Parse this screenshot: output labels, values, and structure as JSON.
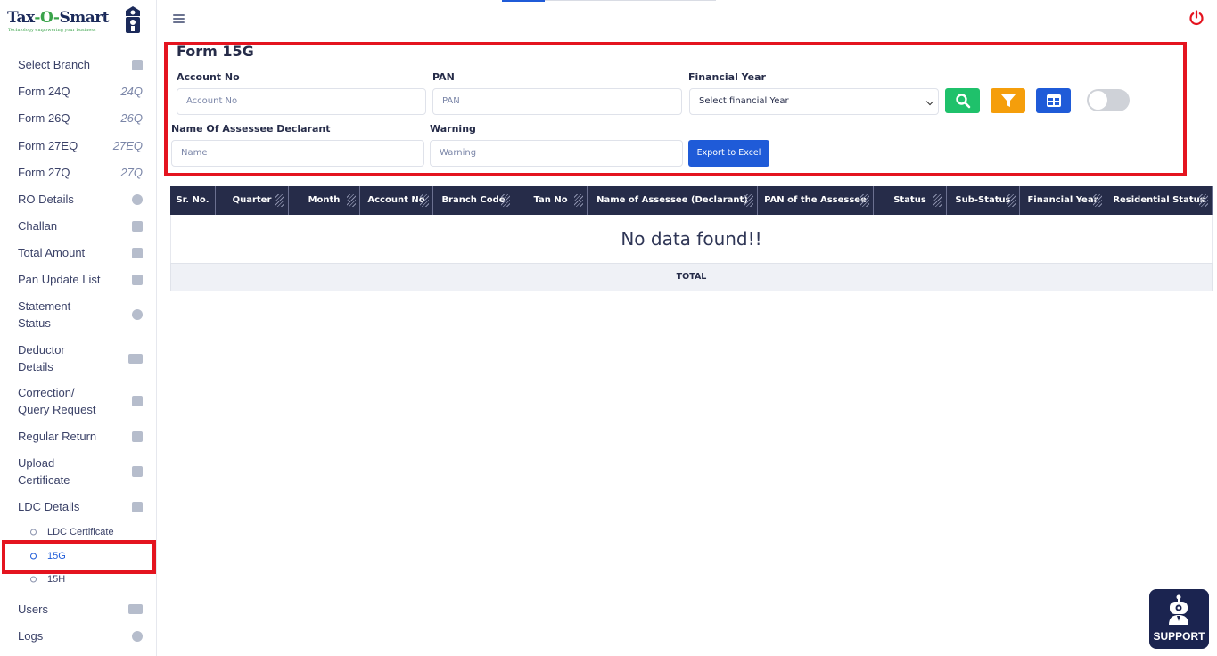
{
  "brand": {
    "name_left": "Tax",
    "name_dash1": "-",
    "name_o": "O",
    "name_dash2": "-",
    "name_right": "Smart",
    "tagline": "Technology empowering your business"
  },
  "sidebar": {
    "items": [
      {
        "label": "Select Branch",
        "icon": "id-card-icon"
      },
      {
        "label": "Form 24Q",
        "abbr": "24Q"
      },
      {
        "label": "Form 26Q",
        "abbr": "26Q"
      },
      {
        "label": "Form 27EQ",
        "abbr": "27EQ"
      },
      {
        "label": "Form 27Q",
        "abbr": "27Q"
      },
      {
        "label": "RO Details",
        "icon": "info-icon"
      },
      {
        "label": "Challan",
        "icon": "receipt-icon"
      },
      {
        "label": "Total Amount",
        "icon": "wallet-icon"
      },
      {
        "label": "Pan Update List",
        "icon": "clipboard-icon"
      },
      {
        "label": "Statement Status",
        "line1": "Statement",
        "line2": "Status",
        "icon": "clock-icon"
      },
      {
        "label": "Deductor Details",
        "line1": "Deductor",
        "line2": "Details",
        "icon": "credit-card-icon"
      },
      {
        "label": "Correction/ Query Request",
        "line1": "Correction/",
        "line2": "Query Request",
        "icon": "calendar-icon"
      },
      {
        "label": "Regular Return",
        "icon": "file-icon"
      },
      {
        "label": "Upload Certificate",
        "line1": "Upload",
        "line2": "Certificate",
        "icon": "file-upload-icon"
      },
      {
        "label": "LDC Details",
        "icon": "certificate-icon"
      }
    ],
    "sub_items": [
      {
        "label": "LDC Certificate"
      },
      {
        "label": "15G"
      },
      {
        "label": "15H"
      }
    ],
    "bottom_items": [
      {
        "label": "Users",
        "icon": "users-icon"
      },
      {
        "label": "Logs",
        "icon": "history-icon"
      }
    ]
  },
  "page": {
    "title": "Form 15G",
    "filters": {
      "account_no_label": "Account No",
      "account_no_placeholder": "Account No",
      "pan_label": "PAN",
      "pan_placeholder": "PAN",
      "fy_label": "Financial Year",
      "fy_selected": "Select financial Year",
      "name_label": "Name Of Assessee Declarant",
      "name_placeholder": "Name",
      "warning_label": "Warning",
      "warning_placeholder": "Warning",
      "export_label": "Export to Excel"
    },
    "buttons_colors": {
      "search": "#1fc16b",
      "filter": "#f59e0b",
      "grid": "#1f5bd8"
    }
  },
  "table": {
    "columns": [
      "Sr. No.",
      "Quarter",
      "Month",
      "Account No",
      "Branch Code",
      "Tan No",
      "Name of Assessee (Declarant)",
      "PAN of the Assessee",
      "Status",
      "Sub-Status",
      "Financial Year",
      "Residential Status"
    ],
    "empty_message": "No data found!!",
    "total_label": "TOTAL"
  },
  "support": {
    "label": "SUPPORT"
  },
  "colors": {
    "highlight": "#e4141f",
    "header_bg": "#262c49",
    "accent": "#1f5bd8"
  }
}
